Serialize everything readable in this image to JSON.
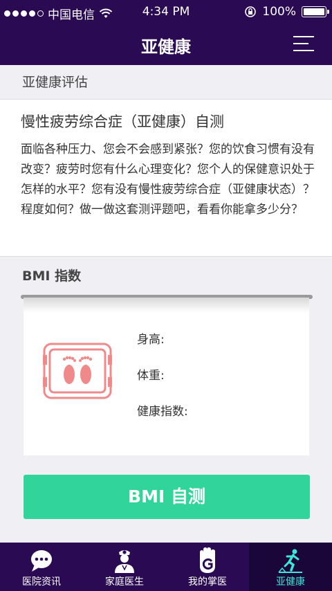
{
  "status_bar": {
    "carrier": "中国电信",
    "time": "4:34 PM",
    "battery": "100%"
  },
  "header": {
    "title": "亚健康"
  },
  "assessment": {
    "section_title": "亚健康评估",
    "title": "慢性疲劳综合症（亚健康）自测",
    "description": "面临各种压力、您会不会感到紧张？您的饮食习惯有没有改变？疲劳时您有什么心理变化？您个人的保健意识处于怎样的水平？您有没有慢性疲劳综合症（亚健康状态）？程度如何？做一做这套测评题吧，看看你能拿多少分？"
  },
  "bmi": {
    "section_title": "BMI 指数",
    "height_label": "身高:",
    "weight_label": "体重:",
    "index_label": "健康指数:",
    "button_label": "BMI 自测"
  },
  "tabbar": {
    "tabs": [
      {
        "label": "医院资讯",
        "icon": "chat-bubble-icon"
      },
      {
        "label": "家庭医生",
        "icon": "doctor-icon"
      },
      {
        "label": "我的掌医",
        "icon": "hand-g-icon"
      },
      {
        "label": "亚健康",
        "icon": "running-icon"
      }
    ],
    "active_index": 3
  },
  "colors": {
    "primary": "#2a0a52",
    "accent_green": "#31d49b",
    "active_tab_text": "#3ee6d6",
    "scale_icon": "#f08a8a"
  }
}
